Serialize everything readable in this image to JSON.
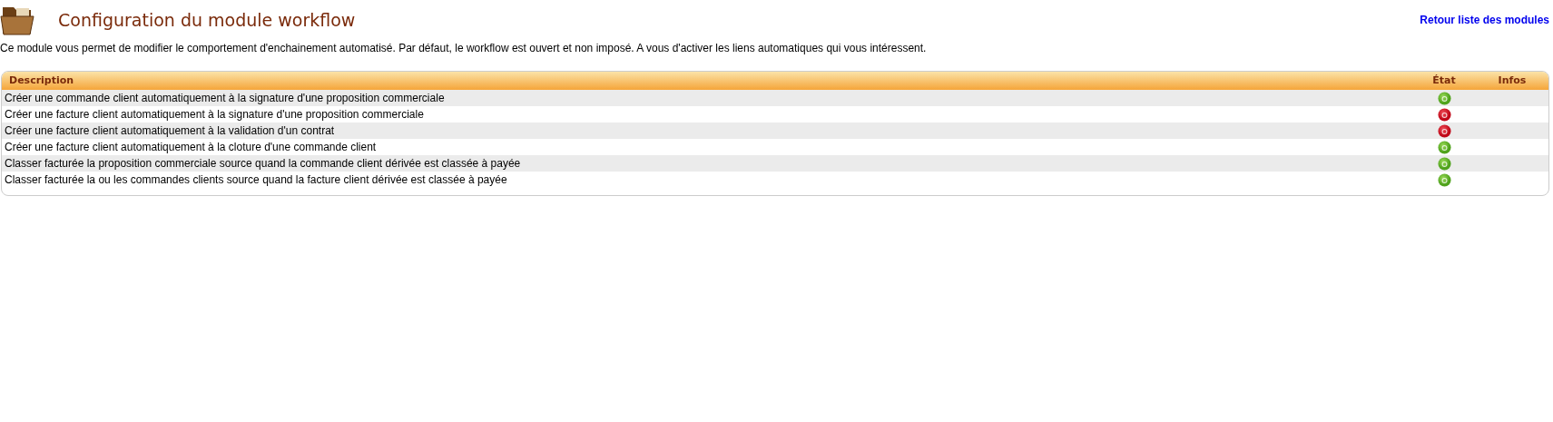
{
  "page": {
    "title": "Configuration du module workflow",
    "back_link": "Retour liste des modules",
    "intro": "Ce module vous permet de modifier le comportement d'enchainement automatisé. Par défaut, le workflow est ouvert et non imposé. A vous d'activer les liens automatiques qui vous intéressent."
  },
  "table": {
    "columns": [
      "Description",
      "État",
      "Infos"
    ],
    "rows": [
      {
        "description": "Créer une commande client automatiquement à la signature d'une proposition commerciale",
        "on": true
      },
      {
        "description": "Créer une facture client automatiquement à la signature d'une proposition commerciale",
        "on": false
      },
      {
        "description": "Créer une facture client automatiquement à la validation d'un contrat",
        "on": false
      },
      {
        "description": "Créer une facture client automatiquement à la cloture d'une commande client",
        "on": true
      },
      {
        "description": "Classer facturée la proposition commerciale source quand la commande client dérivée est classée à payée",
        "on": true
      },
      {
        "description": "Classer facturée la ou les commandes clients source quand la facture client dérivée est classée à payée",
        "on": true
      }
    ]
  }
}
